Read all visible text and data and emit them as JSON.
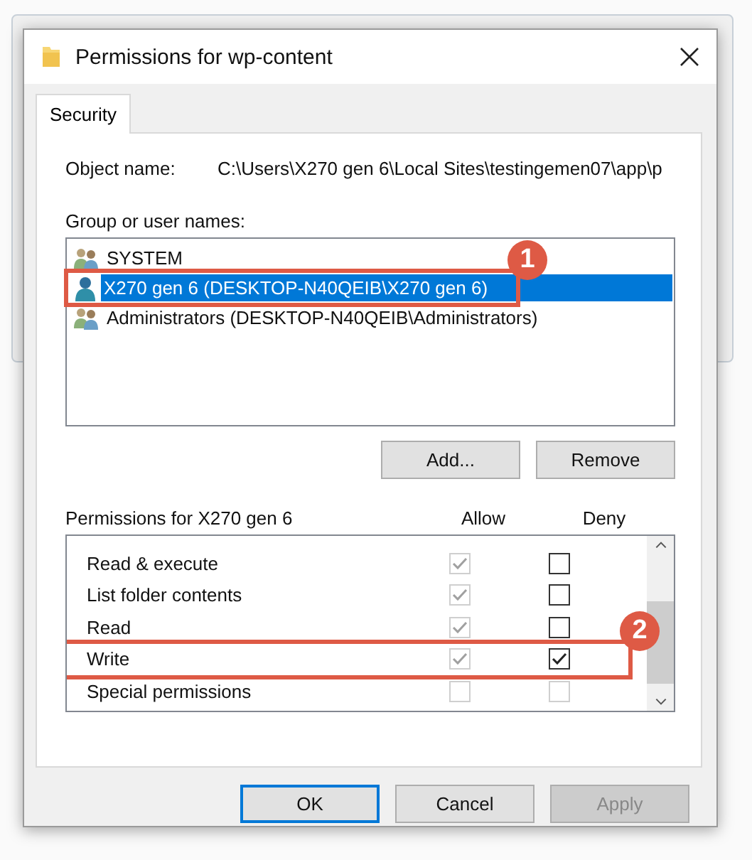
{
  "window": {
    "title": "Permissions for wp-content"
  },
  "tabs": [
    {
      "label": "Security",
      "selected": true
    }
  ],
  "object_name": {
    "label": "Object name:",
    "value": "C:\\Users\\X270 gen 6\\Local Sites\\testingemen07\\app\\p"
  },
  "users": {
    "label": "Group or user names:",
    "items": [
      {
        "name": "SYSTEM",
        "kind": "group",
        "selected": false
      },
      {
        "name": "X270 gen 6 (DESKTOP-N40QEIB\\X270 gen 6)",
        "kind": "user",
        "selected": true,
        "callout": "1"
      },
      {
        "name": "Administrators (DESKTOP-N40QEIB\\Administrators)",
        "kind": "group",
        "selected": false
      }
    ]
  },
  "user_buttons": [
    {
      "label": "Add..."
    },
    {
      "label": "Remove"
    }
  ],
  "permissions": {
    "label": "Permissions for X270 gen 6",
    "allow_header": "Allow",
    "deny_header": "Deny",
    "rows": [
      {
        "name": "Read & execute",
        "allow": true,
        "allow_disabled": true,
        "deny": false,
        "deny_disabled": false
      },
      {
        "name": "List folder contents",
        "allow": true,
        "allow_disabled": true,
        "deny": false,
        "deny_disabled": false
      },
      {
        "name": "Read",
        "allow": true,
        "allow_disabled": true,
        "deny": false,
        "deny_disabled": false
      },
      {
        "name": "Write",
        "allow": true,
        "allow_disabled": true,
        "deny": true,
        "deny_disabled": false,
        "callout": "2"
      },
      {
        "name": "Special permissions",
        "allow": false,
        "allow_disabled": true,
        "deny": false,
        "deny_disabled": true
      }
    ]
  },
  "buttons": [
    {
      "label": "OK",
      "default": true,
      "disabled": false
    },
    {
      "label": "Cancel",
      "default": false,
      "disabled": false
    },
    {
      "label": "Apply",
      "default": false,
      "disabled": true
    }
  ]
}
